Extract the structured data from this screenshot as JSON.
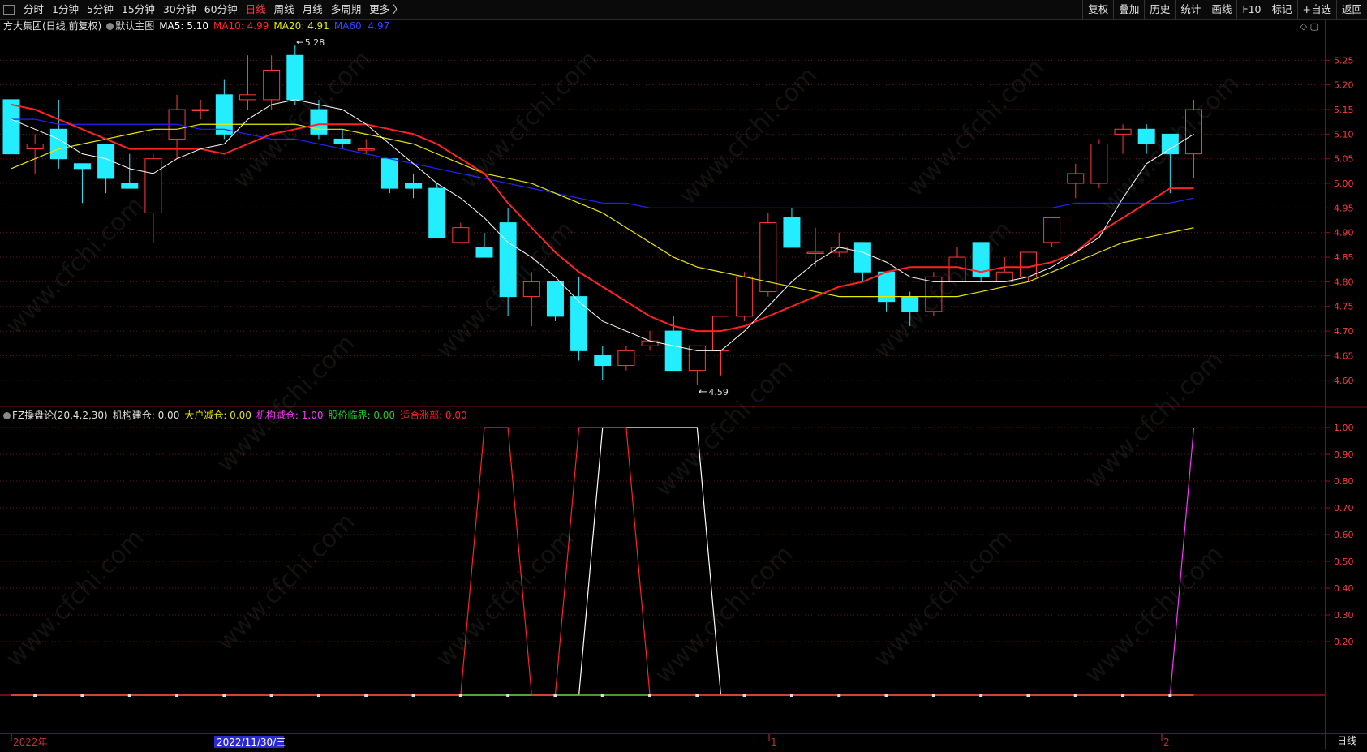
{
  "toolbar": {
    "left_items": [
      "分时",
      "1分钟",
      "5分钟",
      "15分钟",
      "30分钟",
      "60分钟",
      "日线",
      "周线",
      "月线",
      "多周期",
      "更多 〉"
    ],
    "active_index": 6,
    "right_items": [
      "复权",
      "叠加",
      "历史",
      "统计",
      "画线",
      "F10",
      "标记",
      "+自选",
      "返回"
    ]
  },
  "main_chart": {
    "stock_label": "方大集团(日线,前复权)",
    "template_label": "默认主图",
    "ma5_label": "MA5: 5.10",
    "ma10_label": "MA10: 4.99",
    "ma20_label": "MA20: 4.91",
    "ma60_label": "MA60: 4.97",
    "high_marker": "5.28",
    "low_marker": "4.59"
  },
  "indicator": {
    "name_label": "FZ操盘论(20,4,2,30)",
    "inst_build_label": "机构建仓: 0.00",
    "big_reduce_label": "大户减仓: 0.00",
    "inst_reduce_label": "机构减仓: 1.00",
    "price_critical_label": "股价临界: 0.00",
    "fit_rise_label": "适合涨部: 0.00"
  },
  "colors": {
    "up": "#ff3b3b",
    "down": "#22eeff",
    "ma5": "#ffffff",
    "ma10": "#ff2222",
    "ma20": "#e8e800",
    "ma60": "#2222ff",
    "grid": "#6a0f0f",
    "magenta": "#ff33ff",
    "green": "#22cc22"
  },
  "bottom_axis": {
    "labels": [
      "2022年",
      "2022/11/30/三",
      "1",
      "2"
    ]
  },
  "period": "日线",
  "watermark": "www.cfchi.com",
  "chart_data": [
    {
      "type": "candlestick",
      "title": "方大集团(日线,前复权)",
      "price_axis_ticks": [
        5.25,
        5.2,
        5.15,
        5.1,
        5.05,
        5.0,
        4.95,
        4.9,
        4.85,
        4.8,
        4.75,
        4.7,
        4.65,
        4.6
      ],
      "ylim": [
        4.565,
        5.3
      ],
      "candles": [
        {
          "o": 5.17,
          "c": 5.06,
          "h": 5.17,
          "l": 5.06
        },
        {
          "o": 5.07,
          "c": 5.08,
          "h": 5.1,
          "l": 5.02
        },
        {
          "o": 5.11,
          "c": 5.05,
          "h": 5.17,
          "l": 5.03
        },
        {
          "o": 5.04,
          "c": 5.03,
          "h": 5.04,
          "l": 4.96
        },
        {
          "o": 5.08,
          "c": 5.01,
          "h": 5.08,
          "l": 4.98
        },
        {
          "o": 5.0,
          "c": 4.99,
          "h": 5.06,
          "l": 4.99
        },
        {
          "o": 4.94,
          "c": 5.05,
          "h": 5.06,
          "l": 4.88
        },
        {
          "o": 5.09,
          "c": 5.15,
          "h": 5.18,
          "l": 5.05
        },
        {
          "o": 5.15,
          "c": 5.15,
          "h": 5.17,
          "l": 5.13
        },
        {
          "o": 5.18,
          "c": 5.1,
          "h": 5.21,
          "l": 5.09
        },
        {
          "o": 5.17,
          "c": 5.18,
          "h": 5.26,
          "l": 5.15
        },
        {
          "o": 5.17,
          "c": 5.23,
          "h": 5.26,
          "l": 5.15
        },
        {
          "o": 5.26,
          "c": 5.17,
          "h": 5.28,
          "l": 5.16
        },
        {
          "o": 5.15,
          "c": 5.1,
          "h": 5.17,
          "l": 5.09
        },
        {
          "o": 5.09,
          "c": 5.08,
          "h": 5.11,
          "l": 5.07
        },
        {
          "o": 5.07,
          "c": 5.07,
          "h": 5.09,
          "l": 5.06
        },
        {
          "o": 5.05,
          "c": 4.99,
          "h": 5.05,
          "l": 4.98
        },
        {
          "o": 5.0,
          "c": 4.99,
          "h": 5.02,
          "l": 4.97
        },
        {
          "o": 4.99,
          "c": 4.89,
          "h": 5.0,
          "l": 4.89
        },
        {
          "o": 4.88,
          "c": 4.91,
          "h": 4.92,
          "l": 4.88
        },
        {
          "o": 4.87,
          "c": 4.85,
          "h": 4.9,
          "l": 4.85
        },
        {
          "o": 4.92,
          "c": 4.77,
          "h": 4.95,
          "l": 4.73
        },
        {
          "o": 4.77,
          "c": 4.8,
          "h": 4.82,
          "l": 4.71
        },
        {
          "o": 4.8,
          "c": 4.73,
          "h": 4.8,
          "l": 4.72
        },
        {
          "o": 4.77,
          "c": 4.66,
          "h": 4.81,
          "l": 4.64
        },
        {
          "o": 4.65,
          "c": 4.63,
          "h": 4.67,
          "l": 4.6
        },
        {
          "o": 4.63,
          "c": 4.66,
          "h": 4.67,
          "l": 4.62
        },
        {
          "o": 4.67,
          "c": 4.68,
          "h": 4.7,
          "l": 4.66
        },
        {
          "o": 4.7,
          "c": 4.62,
          "h": 4.73,
          "l": 4.62
        },
        {
          "o": 4.62,
          "c": 4.67,
          "h": 4.67,
          "l": 4.59
        },
        {
          "o": 4.66,
          "c": 4.73,
          "h": 4.73,
          "l": 4.61
        },
        {
          "o": 4.73,
          "c": 4.81,
          "h": 4.82,
          "l": 4.72
        },
        {
          "o": 4.78,
          "c": 4.92,
          "h": 4.94,
          "l": 4.77
        },
        {
          "o": 4.93,
          "c": 4.87,
          "h": 4.95,
          "l": 4.87
        },
        {
          "o": 4.86,
          "c": 4.86,
          "h": 4.91,
          "l": 4.83
        },
        {
          "o": 4.86,
          "c": 4.87,
          "h": 4.9,
          "l": 4.85
        },
        {
          "o": 4.88,
          "c": 4.82,
          "h": 4.88,
          "l": 4.8
        },
        {
          "o": 4.82,
          "c": 4.76,
          "h": 4.82,
          "l": 4.74
        },
        {
          "o": 4.77,
          "c": 4.74,
          "h": 4.78,
          "l": 4.71
        },
        {
          "o": 4.74,
          "c": 4.81,
          "h": 4.82,
          "l": 4.73
        },
        {
          "o": 4.8,
          "c": 4.85,
          "h": 4.87,
          "l": 4.8
        },
        {
          "o": 4.88,
          "c": 4.81,
          "h": 4.88,
          "l": 4.8
        },
        {
          "o": 4.8,
          "c": 4.82,
          "h": 4.85,
          "l": 4.8
        },
        {
          "o": 4.81,
          "c": 4.86,
          "h": 4.86,
          "l": 4.8
        },
        {
          "o": 4.88,
          "c": 4.93,
          "h": 4.93,
          "l": 4.87
        },
        {
          "o": 5.0,
          "c": 5.02,
          "h": 5.04,
          "l": 4.97
        },
        {
          "o": 5.0,
          "c": 5.08,
          "h": 5.09,
          "l": 4.99
        },
        {
          "o": 5.1,
          "c": 5.11,
          "h": 5.12,
          "l": 5.06
        },
        {
          "o": 5.11,
          "c": 5.08,
          "h": 5.12,
          "l": 5.06
        },
        {
          "o": 5.1,
          "c": 5.06,
          "h": 5.1,
          "l": 4.98
        },
        {
          "o": 5.06,
          "c": 5.15,
          "h": 5.17,
          "l": 5.01
        }
      ],
      "ma5": [
        5.13,
        5.11,
        5.09,
        5.06,
        5.05,
        5.03,
        5.02,
        5.05,
        5.07,
        5.08,
        5.13,
        5.16,
        5.17,
        5.16,
        5.15,
        5.12,
        5.08,
        5.04,
        5.0,
        4.97,
        4.93,
        4.88,
        4.85,
        4.81,
        4.76,
        4.72,
        4.7,
        4.68,
        4.67,
        4.66,
        4.66,
        4.7,
        4.75,
        4.8,
        4.84,
        4.87,
        4.86,
        4.84,
        4.81,
        4.8,
        4.8,
        4.8,
        4.8,
        4.81,
        4.83,
        4.86,
        4.89,
        4.97,
        5.04,
        5.07,
        5.1
      ],
      "ma10": [
        5.16,
        5.15,
        5.13,
        5.11,
        5.09,
        5.07,
        5.07,
        5.07,
        5.07,
        5.06,
        5.08,
        5.1,
        5.11,
        5.12,
        5.12,
        5.12,
        5.11,
        5.1,
        5.08,
        5.05,
        5.02,
        4.96,
        4.91,
        4.86,
        4.82,
        4.79,
        4.76,
        4.73,
        4.71,
        4.7,
        4.7,
        4.71,
        4.73,
        4.75,
        4.77,
        4.79,
        4.8,
        4.82,
        4.83,
        4.83,
        4.83,
        4.82,
        4.83,
        4.83,
        4.84,
        4.86,
        4.9,
        4.93,
        4.96,
        4.99,
        4.99
      ],
      "ma20": [
        5.03,
        5.05,
        5.07,
        5.08,
        5.09,
        5.1,
        5.11,
        5.11,
        5.12,
        5.12,
        5.12,
        5.12,
        5.12,
        5.11,
        5.11,
        5.1,
        5.09,
        5.08,
        5.06,
        5.04,
        5.02,
        5.01,
        5.0,
        4.98,
        4.96,
        4.94,
        4.91,
        4.88,
        4.85,
        4.83,
        4.82,
        4.81,
        4.8,
        4.79,
        4.78,
        4.77,
        4.77,
        4.77,
        4.77,
        4.77,
        4.77,
        4.78,
        4.79,
        4.8,
        4.82,
        4.84,
        4.86,
        4.88,
        4.89,
        4.9,
        4.91
      ],
      "ma60": [
        5.13,
        5.13,
        5.12,
        5.12,
        5.12,
        5.12,
        5.12,
        5.12,
        5.11,
        5.11,
        5.1,
        5.09,
        5.09,
        5.08,
        5.07,
        5.06,
        5.05,
        5.04,
        5.03,
        5.02,
        5.01,
        5.0,
        4.99,
        4.98,
        4.97,
        4.96,
        4.96,
        4.95,
        4.95,
        4.95,
        4.95,
        4.95,
        4.95,
        4.95,
        4.95,
        4.95,
        4.95,
        4.95,
        4.95,
        4.95,
        4.95,
        4.95,
        4.95,
        4.95,
        4.95,
        4.96,
        4.96,
        4.96,
        4.96,
        4.96,
        4.97
      ]
    },
    {
      "type": "line",
      "title": "FZ操盘论(20,4,2,30)",
      "value_axis_ticks": [
        1.0,
        0.9,
        0.8,
        0.7,
        0.6,
        0.5,
        0.4,
        0.3,
        0.2
      ],
      "ylim": [
        0,
        1.06
      ],
      "series": [
        {
          "name": "机构建仓",
          "color": "#ffffff",
          "values": [
            0,
            0,
            0,
            0,
            0,
            0,
            0,
            0,
            0,
            0,
            0,
            0,
            0,
            0,
            0,
            0,
            0,
            0,
            0,
            0,
            0,
            0,
            0,
            0,
            0,
            1,
            1,
            1,
            1,
            1,
            0,
            0,
            0,
            0,
            0,
            0,
            0,
            0,
            0,
            0,
            0,
            0,
            0,
            0,
            0,
            0,
            0,
            0,
            0,
            0,
            0
          ]
        },
        {
          "name": "大户减仓",
          "color": "#e8e800",
          "values": [
            0,
            0,
            0,
            0,
            0,
            0,
            0,
            0,
            0,
            0,
            0,
            0,
            0,
            0,
            0,
            0,
            0,
            0,
            0,
            0,
            0,
            0,
            0,
            0,
            0,
            0,
            0,
            0,
            0,
            0,
            0,
            0,
            0,
            0,
            0,
            0,
            0,
            0,
            0,
            0,
            0,
            0,
            0,
            0,
            0,
            0,
            0,
            0,
            0,
            0,
            0
          ]
        },
        {
          "name": "机构减仓",
          "color": "#ff33ff",
          "values": [
            0,
            0,
            0,
            0,
            0,
            0,
            0,
            0,
            0,
            0,
            0,
            0,
            0,
            0,
            0,
            0,
            0,
            0,
            0,
            0,
            0,
            0,
            0,
            0,
            0,
            0,
            0,
            0,
            0,
            0,
            0,
            0,
            0,
            0,
            0,
            0,
            0,
            0,
            0,
            0,
            0,
            0,
            0,
            0,
            0,
            0,
            0,
            0,
            0,
            0,
            1
          ]
        },
        {
          "name": "股价临界",
          "color": "#22cc22",
          "values": [
            0,
            0,
            0,
            0,
            0,
            0,
            0,
            0,
            0,
            0,
            0,
            0,
            0,
            0,
            0,
            0,
            0,
            0,
            0,
            0,
            0,
            0,
            0,
            0,
            0,
            0,
            0,
            0,
            0,
            0,
            0,
            0,
            0,
            0,
            0,
            0,
            0,
            0,
            0,
            0,
            0,
            0,
            0,
            0,
            0,
            0,
            0,
            0,
            0,
            0,
            0
          ]
        },
        {
          "name": "适合涨部",
          "color": "#ff2222",
          "values": [
            0,
            0,
            0,
            0,
            0,
            0,
            0,
            0,
            0,
            0,
            0,
            0,
            0,
            0,
            0,
            0,
            0,
            0,
            0,
            0,
            1,
            1,
            0,
            0,
            1,
            1,
            1,
            0,
            0,
            0,
            0,
            0,
            0,
            0,
            0,
            0,
            0,
            0,
            0,
            0,
            0,
            0,
            0,
            0,
            0,
            0,
            0,
            0,
            0,
            0,
            0
          ]
        }
      ]
    }
  ]
}
